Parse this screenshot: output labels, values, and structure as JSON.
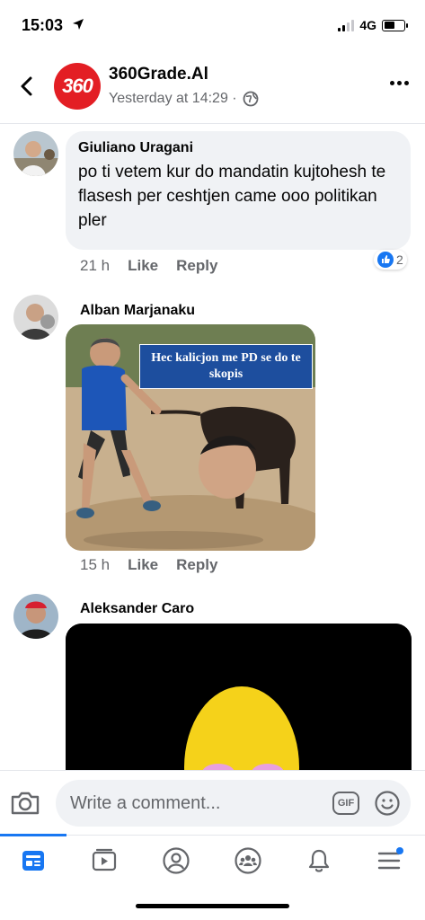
{
  "status_bar": {
    "time": "15:03",
    "network": "4G"
  },
  "header": {
    "page_name": "360Grade.Al",
    "logo_text": "360",
    "timestamp": "Yesterday at 14:29 ·",
    "icons": {
      "back": "back-chevron-icon",
      "privacy": "globe-icon",
      "more": "more-dots-icon"
    }
  },
  "comments": [
    {
      "author": "Giuliano Uragani",
      "text": "po ti vetem kur do mandatin kujtohesh te flasesh per ceshtjen came ooo politikan pler",
      "time": "21 h",
      "like_label": "Like",
      "reply_label": "Reply",
      "reactions": {
        "icon": "thumbs-up-icon",
        "count": "2"
      }
    },
    {
      "author": "Alban Marjanaku",
      "meme_caption": "Hec kalicjon me PD se do te skopis",
      "time": "15 h",
      "like_label": "Like",
      "reply_label": "Reply"
    },
    {
      "author": "Aleksander Caro"
    }
  ],
  "composer": {
    "placeholder": "Write a comment...",
    "gif_label": "GIF",
    "icons": {
      "camera": "camera-icon",
      "emoji": "emoji-icon"
    }
  },
  "tab_bar": {
    "active_color": "#1877f2",
    "tabs": [
      "news-feed-icon",
      "watch-icon",
      "profile-icon",
      "groups-icon",
      "notifications-icon",
      "menu-icon"
    ]
  }
}
